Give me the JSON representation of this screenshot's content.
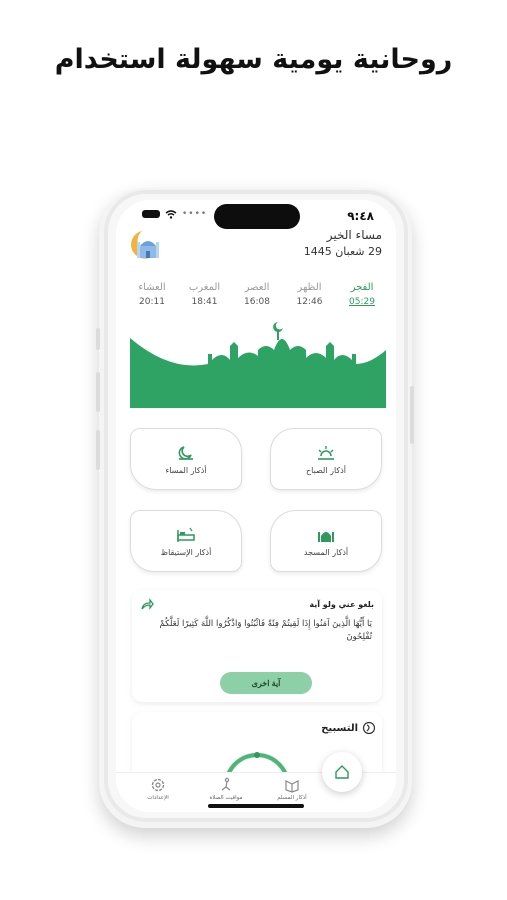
{
  "headline": "روحانية يومية سهولة استخدام",
  "status_bar": {
    "time": "٩:٤٨"
  },
  "header": {
    "greeting": "مساء الخير",
    "hijri_date": "29 شعبان 1445"
  },
  "prayers": [
    {
      "name": "الفجر",
      "time": "05:29",
      "active": true
    },
    {
      "name": "الظهر",
      "time": "12:46",
      "active": false
    },
    {
      "name": "العصر",
      "time": "16:08",
      "active": false
    },
    {
      "name": "المغرب",
      "time": "18:41",
      "active": false
    },
    {
      "name": "العشاء",
      "time": "20:11",
      "active": false
    }
  ],
  "cards": {
    "morning": "أذكار الصباح",
    "evening": "أذكار المساء",
    "mosque": "أذكار المسجد",
    "wakeup": "أذكار الإستيقاظ"
  },
  "verse": {
    "title": "بلغو عني ولو آية",
    "text": "يَا أَيُّهَا الَّذِينَ آمَنُوا إِذَا لَقِيتُمْ فِئَةً فَاثْبُتُوا وَاذْكُرُوا اللَّهَ كَثِيرًا لَعَلَّكُمْ تُفْلِحُونَ",
    "button": "آية اخرى"
  },
  "tasbih": {
    "title": "التسبيح"
  },
  "tabbar": {
    "settings": "الإعدادات",
    "prayer_times": "مواقيت الصلاة",
    "adhkar": "أذكار المسلم"
  },
  "colors": {
    "accent": "#2e9a5c",
    "button": "#8dcfa6"
  },
  "icons": [
    "share-icon",
    "tasbih-icon",
    "settings-icon",
    "prayer-icon",
    "adhkar-icon",
    "home-icon",
    "sun-icon",
    "moon-icon",
    "mosque-icon",
    "bed-icon"
  ]
}
